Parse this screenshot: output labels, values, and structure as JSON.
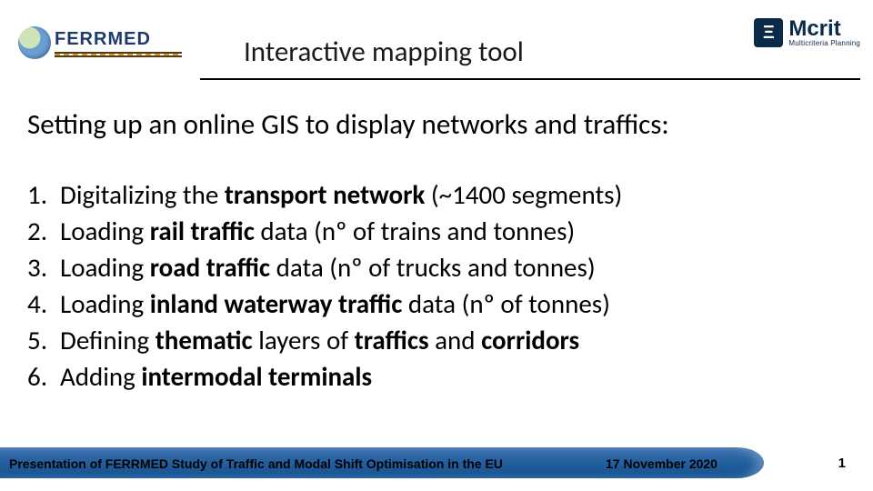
{
  "header": {
    "ferrmed_text": "FERRMED",
    "title": "Interactive mapping tool",
    "mcrit_mark": "Ξ",
    "mcrit_name": "Mcrit",
    "mcrit_tag": "Multicriteria Planning"
  },
  "body": {
    "subtitle": "Setting up an online GIS to display networks and traffics:",
    "items": [
      {
        "num": "1.",
        "pre": "Digitalizing the ",
        "bold": "transport network",
        "post": " (~1400 segments)"
      },
      {
        "num": "2.",
        "pre": "Loading ",
        "bold": "rail traffic",
        "post": " data (nº of trains and tonnes)"
      },
      {
        "num": "3.",
        "pre": "Loading ",
        "bold": "road traffic",
        "post": " data (nº of trucks and tonnes)"
      },
      {
        "num": "4.",
        "pre": "Loading ",
        "bold": "inland waterway traffic",
        "post": " data (nº of tonnes)"
      },
      {
        "num": "5.",
        "pre": "Defining ",
        "bold": "thematic",
        "post_mid": " layers of ",
        "bold2": "traffics",
        "post_mid2": " and ",
        "bold3": "corridors",
        "post": ""
      },
      {
        "num": "6.",
        "pre": "Adding ",
        "bold": "intermodal terminals",
        "post": ""
      }
    ]
  },
  "footer": {
    "left": "Presentation of FERRMED Study of Traffic and Modal Shift Optimisation in the EU",
    "date": "17 November 2020",
    "page": "1"
  }
}
